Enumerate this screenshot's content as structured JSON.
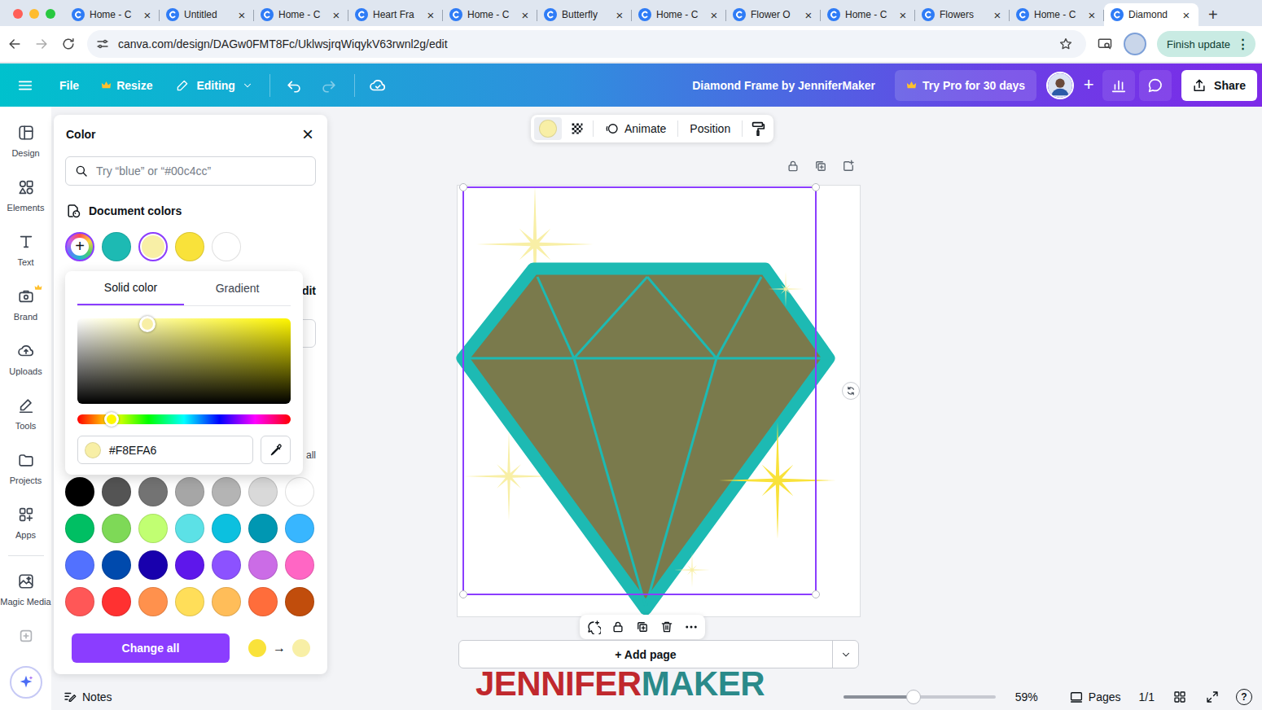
{
  "browser": {
    "tabs": [
      {
        "label": "Home - C",
        "close": "×",
        "selected": false
      },
      {
        "label": "Untitled",
        "close": "×",
        "selected": false
      },
      {
        "label": "Home - C",
        "close": "×",
        "selected": false
      },
      {
        "label": "Heart Fra",
        "close": "×",
        "selected": false
      },
      {
        "label": "Home - C",
        "close": "×",
        "selected": false
      },
      {
        "label": "Butterfly",
        "close": "×",
        "selected": false
      },
      {
        "label": "Home - C",
        "close": "×",
        "selected": false
      },
      {
        "label": "Flower O",
        "close": "×",
        "selected": false
      },
      {
        "label": "Home - C",
        "close": "×",
        "selected": false
      },
      {
        "label": "Flowers",
        "close": "×",
        "selected": false
      },
      {
        "label": "Home - C",
        "close": "×",
        "selected": false
      },
      {
        "label": "Diamond",
        "close": "×",
        "selected": true
      }
    ],
    "new_tab": "+",
    "url": "canva.com/design/DAGw0FMT8Fc/UklwsjrqWiqykV63rwnl2g/edit",
    "update_button": "Finish update",
    "more": "⋮"
  },
  "editor_header": {
    "file": "File",
    "resize": {
      "label": "Resize",
      "pro": true
    },
    "mode": "Editing",
    "undo_disabled": false,
    "redo_disabled": true,
    "title": "Diamond Frame by JenniferMaker",
    "try_pro": "Try Pro for 30 days",
    "add_people": "+",
    "share": "Share"
  },
  "sidebar": {
    "items": [
      {
        "label": "Design",
        "pro": false
      },
      {
        "label": "Elements",
        "pro": false
      },
      {
        "label": "Text",
        "pro": false
      },
      {
        "label": "Brand",
        "pro": true
      },
      {
        "label": "Uploads",
        "pro": false
      },
      {
        "label": "Tools",
        "pro": false
      },
      {
        "label": "Projects",
        "pro": false
      },
      {
        "label": "Apps",
        "pro": false
      }
    ],
    "extra_items": [
      {
        "label": "Magic Media"
      }
    ]
  },
  "color_panel": {
    "title": "Color",
    "close": "×",
    "search_placeholder": "Try “blue” or “#00c4cc”",
    "document_colors_title": "Document colors",
    "add_color": "+",
    "document_colors": [
      {
        "color": "#1DBAB3",
        "selected": false
      },
      {
        "color": "#F8EFA6",
        "selected": true
      },
      {
        "color": "#F9E23A",
        "selected": false
      },
      {
        "color": "#FFFFFF",
        "selected": false
      }
    ],
    "hidden_fragments": {
      "edit": "dit",
      "see_all": "all"
    },
    "picker": {
      "tabs": [
        {
          "label": "Solid color",
          "selected": true
        },
        {
          "label": "Gradient",
          "selected": false
        }
      ],
      "saturation": 0.33,
      "brightness": 0.93,
      "hue": 0.16,
      "hex": "#F8EFA6"
    },
    "default_colors": [
      {
        "color": "#000000"
      },
      {
        "color": "#545454"
      },
      {
        "color": "#737373"
      },
      {
        "color": "#A6A6A6"
      },
      {
        "color": "#B4B4B4"
      },
      {
        "color": "#D9D9D9"
      },
      {
        "color": "#FFFFFF"
      },
      {
        "color": "#00BF63"
      },
      {
        "color": "#7ED957"
      },
      {
        "color": "#C1FF72"
      },
      {
        "color": "#5CE1E6"
      },
      {
        "color": "#0CC0DF"
      },
      {
        "color": "#0097B2"
      },
      {
        "color": "#38B6FF"
      },
      {
        "color": "#5271FF"
      },
      {
        "color": "#004AAD"
      },
      {
        "color": "#1800AD"
      },
      {
        "color": "#5E17EB"
      },
      {
        "color": "#8C52FF"
      },
      {
        "color": "#CB6CE6"
      },
      {
        "color": "#FF66C4"
      },
      {
        "color": "#FF5757"
      },
      {
        "color": "#FF3131"
      },
      {
        "color": "#FF914D"
      },
      {
        "color": "#FFDE59"
      },
      {
        "color": "#FFBD59"
      },
      {
        "color": "#FF6D3B"
      },
      {
        "color": "#C14D0C"
      }
    ],
    "change_all": {
      "label": "Change all",
      "from": "#F9E23A",
      "arrow": "→",
      "to": "#F8EFA6"
    }
  },
  "canvas": {
    "toolbar": {
      "fill": "#F8EFA6",
      "animate": "Animate",
      "position": "Position"
    },
    "frame_color": "#1DBAB3",
    "stars": [
      {
        "color": "#F8EFA6"
      },
      {
        "color": "#F8EFA6"
      },
      {
        "color": "#F8EFA6"
      },
      {
        "color": "#F9E23A"
      },
      {
        "color": "#F8EFA6"
      }
    ],
    "add_page": "+ Add page"
  },
  "watermark": {
    "first": "JENNIFER",
    "second": "MAKER"
  },
  "footer": {
    "notes": "Notes",
    "zoom_level": 0.46,
    "zoom": "59%",
    "pages": "Pages",
    "page_count": "1/1",
    "help": "?"
  }
}
